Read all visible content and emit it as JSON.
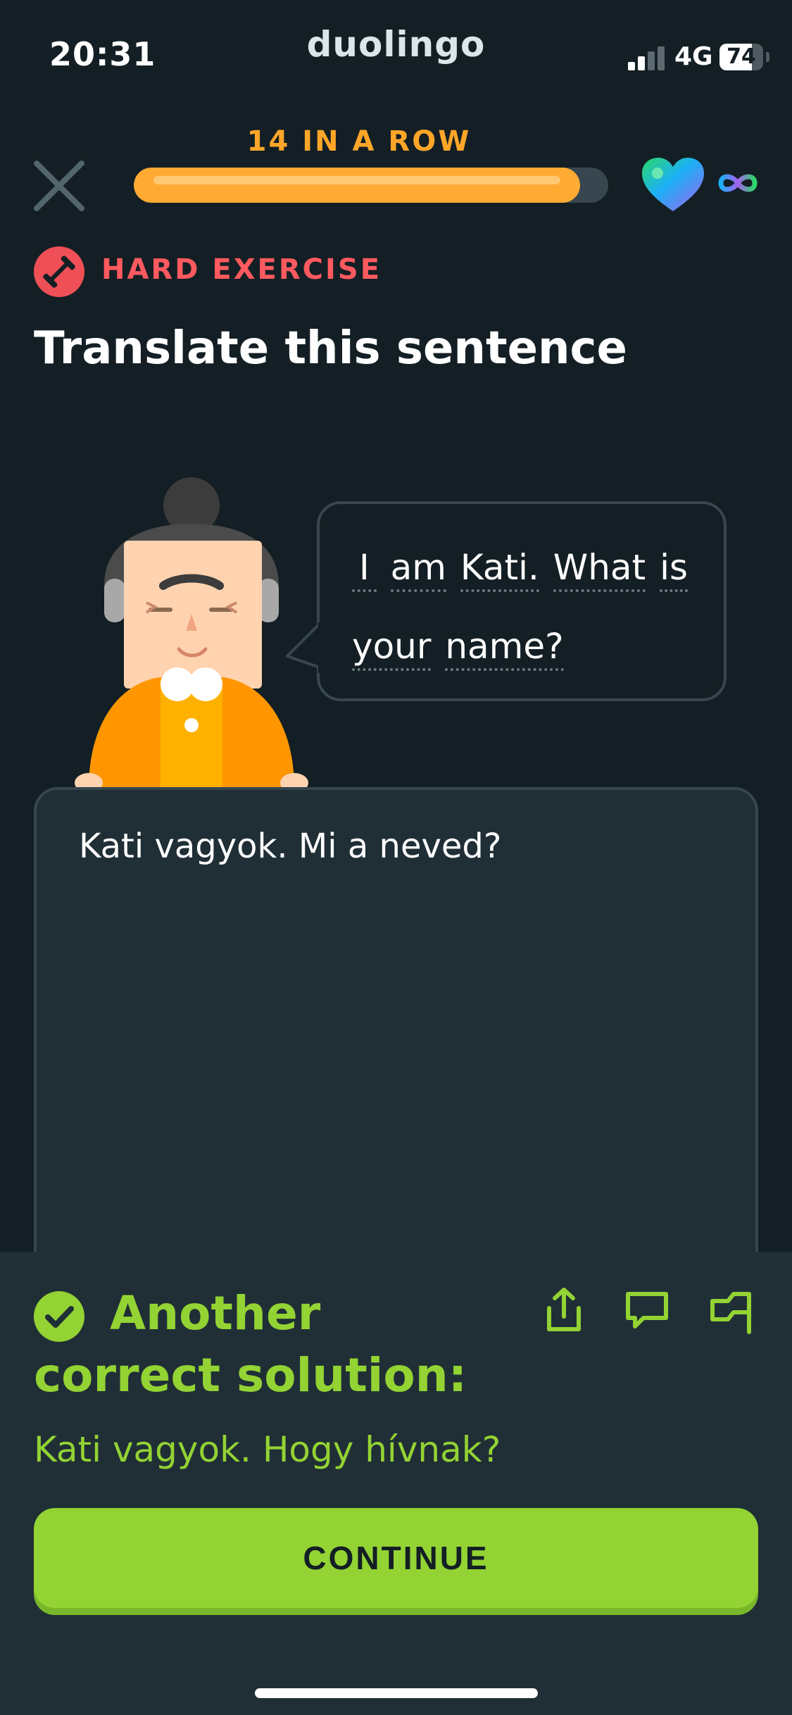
{
  "status_bar": {
    "time": "20:31",
    "brand": "duolingo",
    "network": "4G",
    "battery": "74"
  },
  "lesson": {
    "streak_label": "14 IN A ROW",
    "progress_fraction": 0.94,
    "hearts_icon": "heart-icon",
    "hearts_value": "infinity",
    "hard_label": "HARD EXERCISE",
    "instruction": "Translate this sentence"
  },
  "prompt": {
    "words": [
      "I",
      "am",
      "Kati.",
      "What",
      "is",
      "your",
      "name?"
    ]
  },
  "answer": {
    "text": "Kati vagyok. Mi a neved?"
  },
  "feedback": {
    "title_line1": "Another",
    "title_line2": "correct solution:",
    "solution": "Kati vagyok. Hogy hívnak?",
    "continue_label": "CONTINUE"
  },
  "colors": {
    "background": "#131f24",
    "sheet": "#202f36",
    "success_green": "#93d333",
    "streak_orange": "#ffa629",
    "hard_red": "#ff5a5f"
  }
}
